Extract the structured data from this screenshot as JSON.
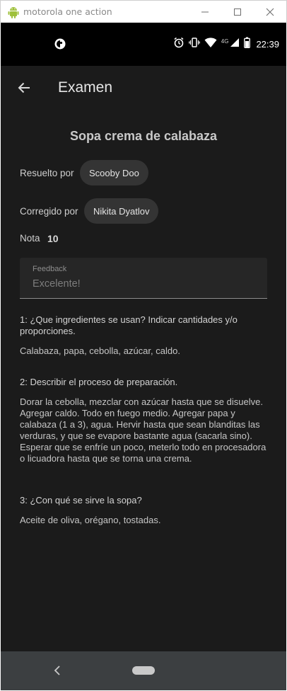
{
  "window": {
    "title": "motorola one action",
    "minimize_icon": "minimize-icon",
    "maximize_icon": "maximize-icon",
    "close_icon": "close-icon"
  },
  "status_bar": {
    "time": "22:39",
    "network": "4G",
    "icons": [
      "app-notification-icon",
      "alarm-icon",
      "vibrate-icon",
      "wifi-icon",
      "signal-icon",
      "battery-icon"
    ]
  },
  "app_bar": {
    "title": "Examen",
    "back_icon": "arrow-left-icon"
  },
  "exam": {
    "recipe_title": "Sopa crema de calabaza",
    "resolved_by_label": "Resuelto por",
    "resolved_by": "Scooby Doo",
    "corrected_by_label": "Corregido por",
    "corrected_by": "Nikita Dyatlov",
    "grade_label": "Nota",
    "grade": "10",
    "feedback_label": "Feedback",
    "feedback_value": "Excelente!"
  },
  "questions": [
    {
      "question": "1: ¿Que ingredientes se usan? Indicar cantidades y/o proporciones.",
      "answer": "Calabaza, papa, cebolla, azúcar, caldo."
    },
    {
      "question": "2: Describir el proceso de preparación.",
      "answer": "Dorar la cebolla, mezclar con azúcar hasta que se disuelve. Agregar caldo. Todo en fuego medio. Agregar papa y calabaza (1 a 3), agua. Hervir hasta que sean blanditas las verduras, y que se evapore bastante agua (sacarla sino). Esperar que se enfríe un poco, meterlo todo en procesadora o licuadora hasta que se torna una crema."
    },
    {
      "question": "3: ¿Con qué se sirve la sopa?",
      "answer": "Aceite de oliva, orégano, tostadas."
    }
  ],
  "nav_bar": {
    "back_icon": "nav-back-icon",
    "home_icon": "home-pill-icon"
  },
  "colors": {
    "background": "#1b1b1b",
    "status_bar": "#000000",
    "chip": "#343434",
    "nav_bar": "#3c3f41"
  }
}
